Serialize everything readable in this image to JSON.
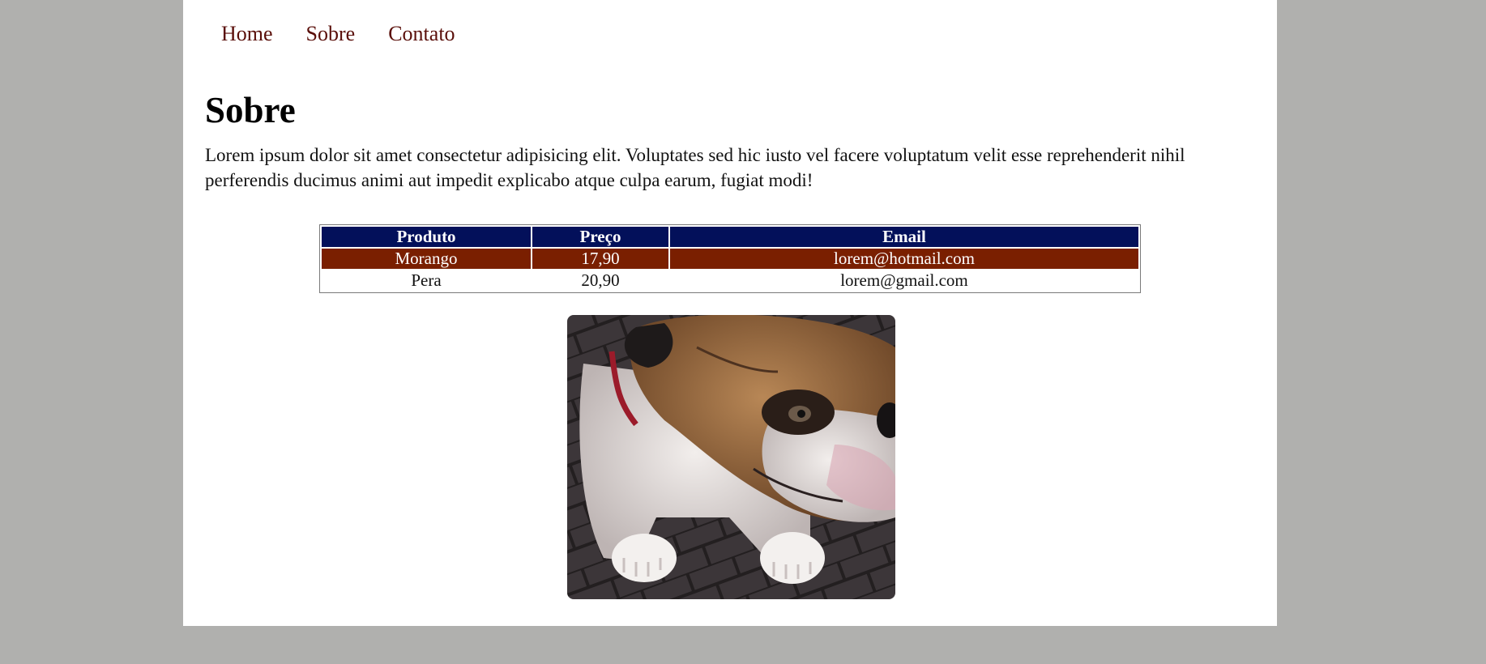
{
  "nav": {
    "items": [
      {
        "label": "Home"
      },
      {
        "label": "Sobre"
      },
      {
        "label": "Contato"
      }
    ]
  },
  "main": {
    "title": "Sobre",
    "paragraph": "Lorem ipsum dolor sit amet consectetur adipisicing elit. Voluptates sed hic iusto vel facere voluptatum velit esse reprehenderit nihil perferendis ducimus animi aut impedit explicabo atque culpa earum, fugiat modi!"
  },
  "table": {
    "headers": [
      "Produto",
      "Preço",
      "Email"
    ],
    "rows": [
      [
        "Morango",
        "17,90",
        "lorem@hotmail.com"
      ],
      [
        "Pera",
        "20,90",
        "lorem@gmail.com"
      ]
    ]
  },
  "colors": {
    "page_background": "#b0b0ae",
    "link": "#5a0f0a",
    "table_header": "#03105a",
    "table_highlight_row": "#7a1f00"
  }
}
